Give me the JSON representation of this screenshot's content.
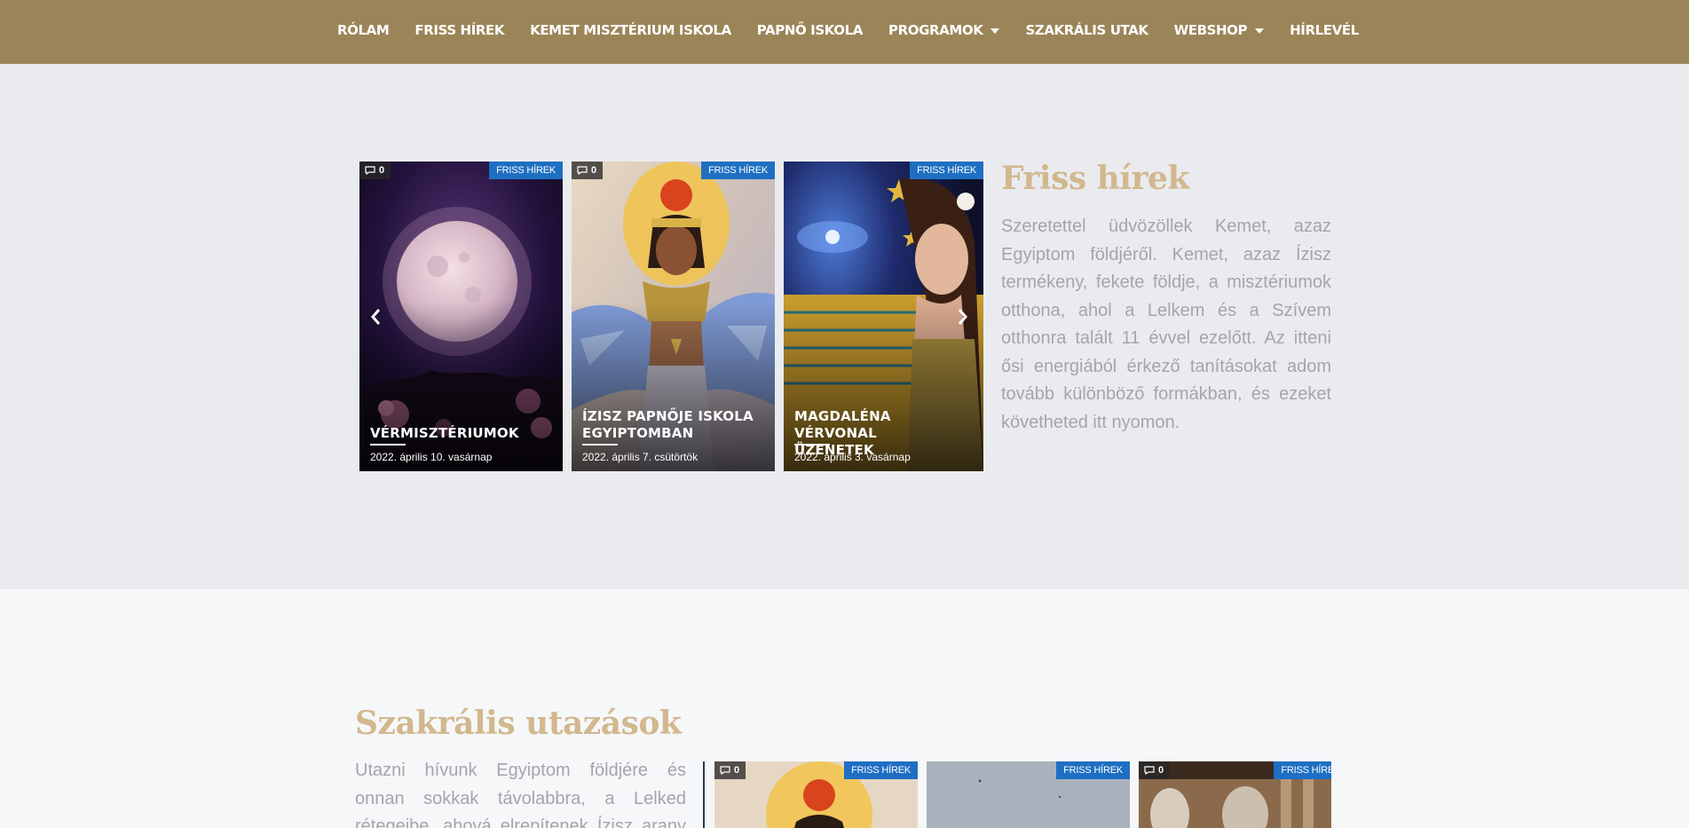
{
  "nav": {
    "items": [
      {
        "label": "RÓLAM",
        "dropdown": false
      },
      {
        "label": "FRISS HÍREK",
        "dropdown": false
      },
      {
        "label": "KEMET MISZTÉRIUM ISKOLA",
        "dropdown": false
      },
      {
        "label": "PAPNŐ ISKOLA",
        "dropdown": false
      },
      {
        "label": "PROGRAMOK",
        "dropdown": true
      },
      {
        "label": "SZAKRÁLIS UTAK",
        "dropdown": false
      },
      {
        "label": "WEBSHOP",
        "dropdown": true
      },
      {
        "label": "HÍRLEVÉL",
        "dropdown": false
      }
    ]
  },
  "news_section": {
    "heading": "Friss hírek",
    "text": "Szeretettel üdvözöllek Kemet, azaz Egyiptom földjéről. Kemet, azaz Ízisz termékeny, fekete földje, a misztériumok otthona, ahol a Lelkem és a Szívem otthonra  talált 11 évvel ezelőtt. Az itteni ősi energiából érkező tanításokat adom tovább különböző formákban, és ezeket követheted itt nyomon.",
    "cards": [
      {
        "comments": "0",
        "category": "FRISS HÍREK",
        "title_line1": "VÉRMISZTÉRIUMOK",
        "title_line2": "",
        "date": "2022. április 10. vasárnap"
      },
      {
        "comments": "0",
        "category": "FRISS HÍREK",
        "title_line1": "ÍZISZ PAPNŐJE ISKOLA",
        "title_line2": "EGYIPTOMBAN",
        "date": "2022. április 7. csütörtök"
      },
      {
        "comments": "",
        "category": "FRISS HÍREK",
        "title_line1": "MAGDALÉNA VÉRVONAL",
        "title_line2": "ÜZENETEK",
        "date": "2022. április 3. vasárnap"
      }
    ]
  },
  "travel_section": {
    "heading": "Szakrális utazások",
    "text_line1": "Utazni hívunk Egyiptom földjére és",
    "text_line2": "onnan sokkak távolabbra, a Lelked",
    "text_line3": "rétegeibe, ahová elrepítenek Ízisz arany",
    "cards": [
      {
        "comments": "0",
        "category": "FRISS HÍREK"
      },
      {
        "comments": "",
        "category": "FRISS HÍREK"
      },
      {
        "comments": "0",
        "category": "FRISS HÍREI"
      }
    ]
  },
  "icons": {
    "comment": "comment-icon",
    "prev": "chevron-left-icon",
    "next": "chevron-right-icon",
    "caret": "caret-down-icon"
  },
  "colors": {
    "nav_bg": "#9b8558",
    "heading": "#d2b88d",
    "badge": "#1e6fc2",
    "body_text": "#a7a3ad"
  }
}
